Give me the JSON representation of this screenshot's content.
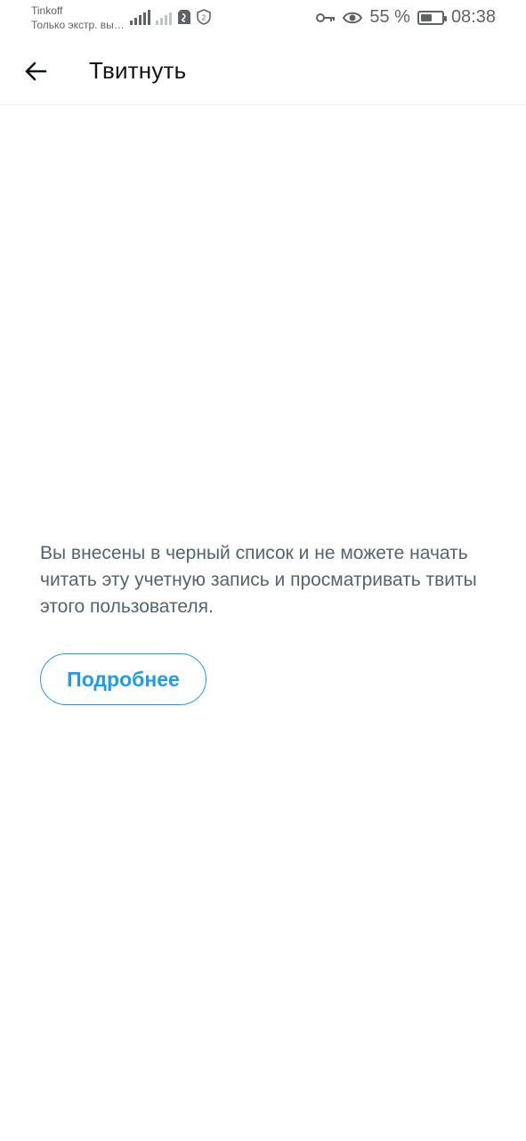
{
  "status_bar": {
    "carrier": "Tinkoff",
    "network_note": "Только экстр. вы…",
    "battery_percent": "55 %",
    "time": "08:38",
    "icons": [
      "signal-icon",
      "signal-off-icon",
      "sim-icon",
      "shield-icon",
      "key-icon",
      "eye-icon",
      "battery-icon"
    ],
    "battery_level": 0.55
  },
  "app_bar": {
    "title": "Твитнуть",
    "back_icon": "arrow-left-icon"
  },
  "content": {
    "message": "Вы внесены в черный список и не можете начать читать эту учетную запись и просматривать твиты этого пользователя.",
    "learn_more_label": "Подробнее"
  },
  "colors": {
    "accent": "#1d9bf0",
    "text_primary": "#0f1419",
    "text_secondary": "#536471",
    "background": "#ffffff"
  }
}
